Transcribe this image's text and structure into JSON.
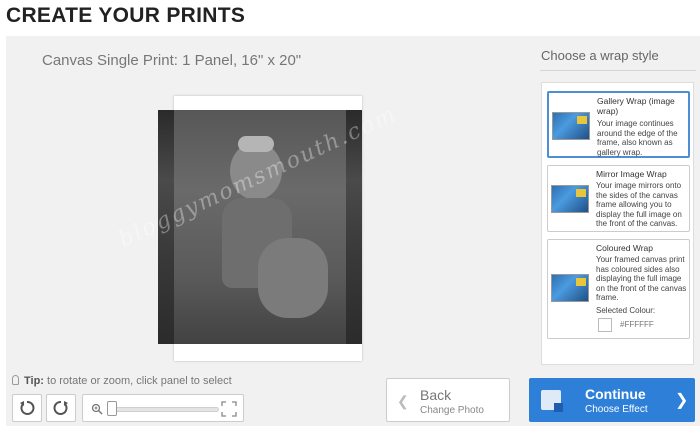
{
  "page": {
    "title": "CREATE YOUR PRINTS"
  },
  "product": {
    "title": "Canvas Single Print: 1 Panel, 16\" x 20\""
  },
  "preview": {
    "watermark": "bloggymomsmouth.com"
  },
  "wrap": {
    "heading": "Choose a wrap style",
    "options": [
      {
        "title": "Gallery Wrap (image wrap)",
        "desc": "Your image continues around the edge of the frame, also known as gallery wrap.",
        "selected": true
      },
      {
        "title": "Mirror Image Wrap",
        "desc": "Your image mirrors onto the sides of the canvas frame allowing you to display the full image on the front of the canvas.",
        "selected": false
      },
      {
        "title": "Coloured Wrap",
        "desc": "Your framed canvas print has coloured sides also displaying the full image on the front of the canvas frame.",
        "selected": false,
        "colour_label": "Selected Colour:",
        "colour_value": "#FFFFFF"
      }
    ]
  },
  "tip": {
    "label": "Tip:",
    "text": "to rotate or zoom, click panel to select"
  },
  "zoom": {
    "level": 0.0
  },
  "nav": {
    "back_label": "Back",
    "back_sub": "Change Photo",
    "continue_label": "Continue",
    "continue_sub": "Choose Effect"
  },
  "colors": {
    "accent": "#2d7fd8",
    "selected_border": "#4e8ed4",
    "panel_bg": "#f1f1f1"
  },
  "icons": [
    "lightbulb-icon",
    "rotate-left-icon",
    "rotate-right-icon",
    "zoom-in-icon",
    "fullscreen-icon",
    "chevron-left-icon",
    "chevron-right-icon",
    "continue-icon"
  ]
}
